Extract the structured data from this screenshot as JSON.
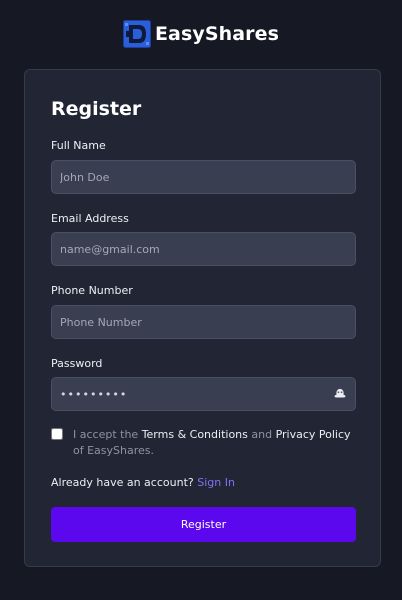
{
  "brand": {
    "name": "EasyShares",
    "logo_icon": "easyshares-logo-icon",
    "logo_color": "#2b5fd9"
  },
  "form": {
    "title": "Register",
    "full_name": {
      "label": "Full Name",
      "placeholder": "John Doe",
      "value": ""
    },
    "email": {
      "label": "Email Address",
      "placeholder": "name@gmail.com",
      "value": ""
    },
    "phone": {
      "label": "Phone Number",
      "placeholder": "Phone Number",
      "value": ""
    },
    "password": {
      "label": "Password",
      "value": "•••••••••",
      "toggle_icon": "eye-icon"
    },
    "terms": {
      "checked": false,
      "prefix": "I accept the ",
      "terms_link": "Terms & Conditions",
      "middle": " and ",
      "privacy_link": "Privacy Policy",
      "suffix": " of EasyShares."
    },
    "signin": {
      "prompt": "Already have an account? ",
      "link": "Sign In"
    },
    "submit_label": "Register"
  },
  "colors": {
    "page_background": "#161823",
    "card_background": "#222533",
    "input_background": "#3a3e51",
    "primary_button": "#5b08ee",
    "link": "#7e74f2"
  }
}
